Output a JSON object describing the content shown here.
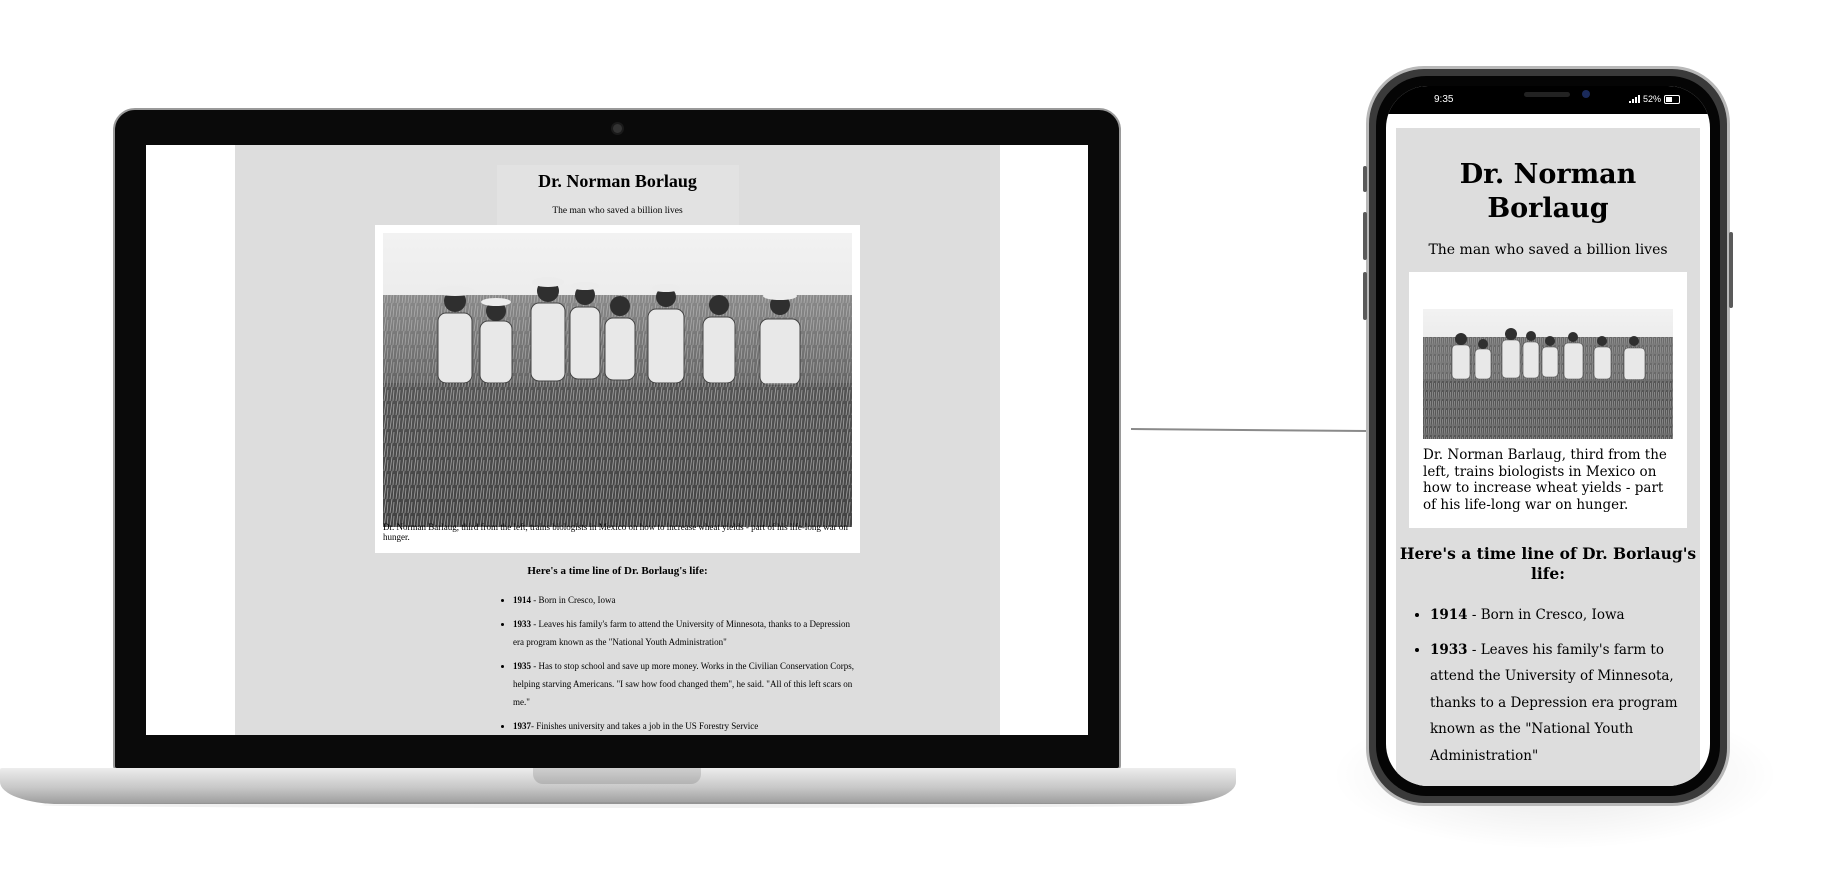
{
  "laptop": {
    "page": {
      "title": "Dr. Norman Borlaug",
      "subtitle": "The man who saved a billion lives",
      "image_alt": "Dr. Norman Borlaug with biologists in a wheat field",
      "caption": "Dr. Norman Barlaug, third from the left, trains biologists in Mexico on how to increase wheat yields - part of his life-long war on hunger.",
      "timeline_heading": "Here's a time line of Dr. Borlaug's life:",
      "timeline": [
        {
          "year": "1914",
          "text": " - Born in Cresco, Iowa"
        },
        {
          "year": "1933",
          "text": " - Leaves his family's farm to attend the University of Minnesota, thanks to a Depression era program known as the \"National Youth Administration\""
        },
        {
          "year": "1935",
          "text": " - Has to stop school and save up more money. Works in the Civilian Conservation Corps, helping starving Americans. \"I saw how food changed them\", he said. \"All of this left scars on me.\""
        },
        {
          "year": "1937",
          "text": "- Finishes university and takes a job in the US Forestry Service"
        }
      ]
    }
  },
  "phone": {
    "status": {
      "time": "9:35",
      "battery": "52%"
    },
    "page": {
      "title": "Dr. Norman Borlaug",
      "subtitle": "The man who saved a billion lives",
      "caption": "Dr. Norman Barlaug, third from the left, trains biologists in Mexico on how to increase wheat yields - part of his life-long war on hunger.",
      "timeline_heading": "Here's a time line of Dr. Borlaug's life:",
      "timeline": [
        {
          "year": "1914",
          "text": " - Born in Cresco, Iowa"
        },
        {
          "year": "1933",
          "text": " - Leaves his family's farm to attend the University of Minnesota, thanks to a Depression era program known as the \"National Youth Administration\""
        }
      ]
    }
  },
  "colors": {
    "page_bg": "#dddddd",
    "device_black": "#0a0a0a",
    "laptop_silver": "#c7c7c7"
  }
}
